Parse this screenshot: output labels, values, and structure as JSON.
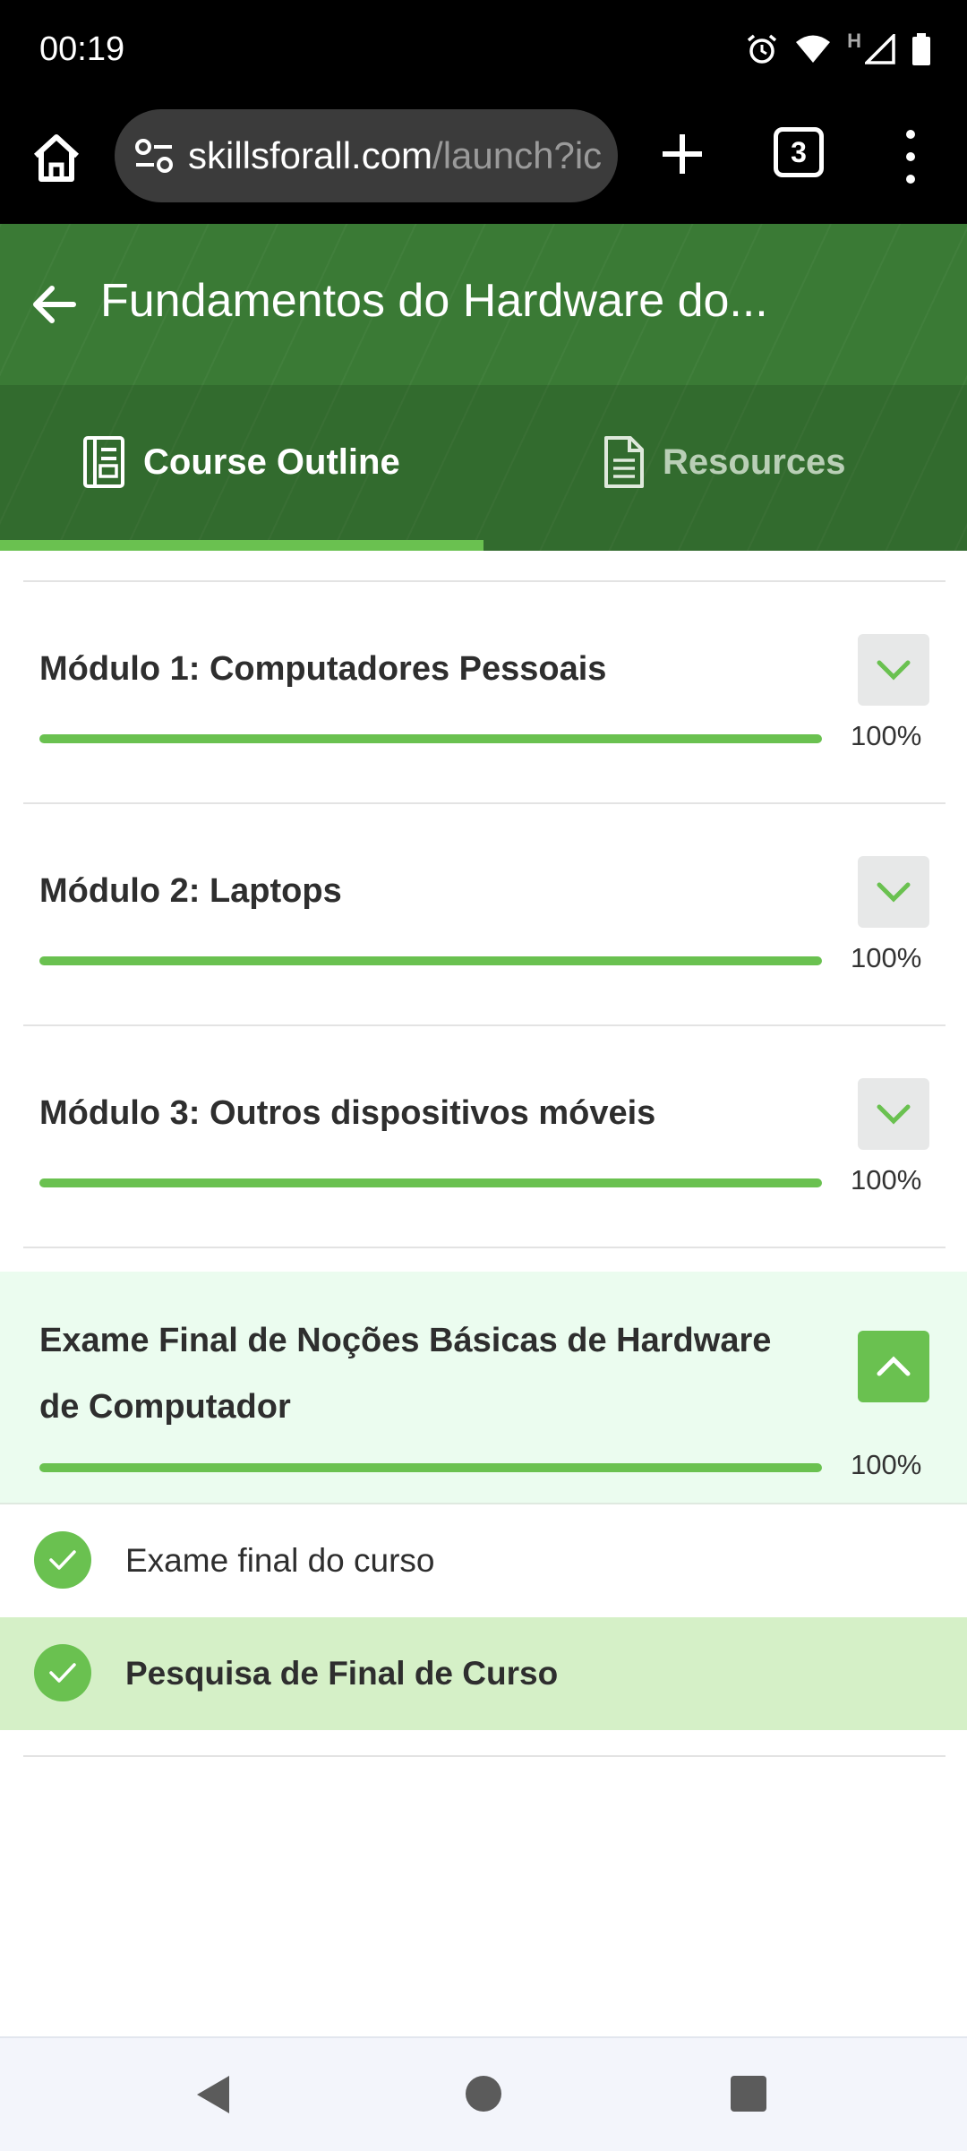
{
  "status_bar": {
    "time": "00:19",
    "icons": [
      "alarm-icon",
      "wifi-icon",
      "signal-icon",
      "battery-icon"
    ],
    "network_label": "H"
  },
  "browser": {
    "url_host": "skillsforall.com",
    "url_path": "/launch?ic",
    "tab_count": "3",
    "icons": [
      "home-icon",
      "site-settings-icon",
      "plus-icon",
      "more-vert-icon"
    ]
  },
  "course": {
    "title": "Fundamentos do Hardware do...",
    "tabs": [
      {
        "label": "Course Outline",
        "icon": "outline-icon",
        "active": true
      },
      {
        "label": "Resources",
        "icon": "document-icon",
        "active": false
      }
    ]
  },
  "modules": [
    {
      "title": "Módulo 1: Computadores Pessoais",
      "progress": 100,
      "progress_label": "100%",
      "expanded": false
    },
    {
      "title": "Módulo 2: Laptops",
      "progress": 100,
      "progress_label": "100%",
      "expanded": false
    },
    {
      "title": "Módulo 3: Outros dispositivos móveis",
      "progress": 100,
      "progress_label": "100%",
      "expanded": false
    }
  ],
  "exam": {
    "title": "Exame Final de Noções Básicas de Hardware de Computador",
    "progress": 100,
    "progress_label": "100%",
    "expanded": true,
    "items": [
      {
        "label": "Exame final do curso",
        "completed": true,
        "selected": false
      },
      {
        "label": "Pesquisa de Final de Curso",
        "completed": true,
        "selected": true
      }
    ]
  },
  "colors": {
    "header_green": "#3a7a35",
    "accent_green": "#6ac150",
    "exam_bg": "#ebfcef",
    "selected_bg": "#d5f0c7"
  }
}
